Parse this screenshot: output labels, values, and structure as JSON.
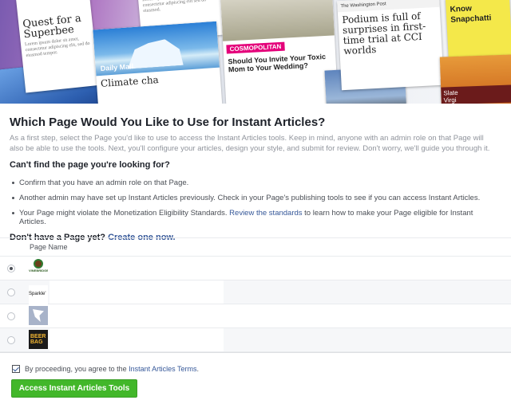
{
  "hero": {
    "cards": {
      "superbee_title": "Quest for a Superbee",
      "climate_title": "Climate cha",
      "dailymail_label": "Daily Mail",
      "cosmo_label": "COSMOPOLITAN",
      "cosmo_title": "Should You Invite Your Toxic Mom to Your Wedding?",
      "wapo_label": "The Washington Post",
      "wapo_title": "Podium is full of surprises in first-time trial at CCI worlds",
      "snap_title": "Know Snapchatti",
      "slate_label": "Slate",
      "slate_text": "Virgi"
    }
  },
  "main": {
    "heading": "Which Page Would You Like to Use for Instant Articles?",
    "intro": "As a first step, select the Page you'd like to use to access the Instant Articles tools. Keep in mind, anyone with an admin role on that Page will also be able to use the tools. Next, you'll configure your articles, design your style, and submit for review. Don't worry, we'll guide you through it.",
    "cant_find": "Can't find the page you're looking for?",
    "tips": {
      "t1": "Confirm that you have an admin role on that Page.",
      "t2": "Another admin may have set up Instant Articles previously. Check in your Page's publishing tools to see if you can access Instant Articles.",
      "t3_before": "Your Page might violate the Monetization Eligibility Standards.",
      "t3_link": "Review the standards",
      "t3_after": "to learn how to make your Page eligible for Instant Articles."
    },
    "no_page": "Don't have a Page yet?",
    "create_link": "Create one now."
  },
  "table": {
    "column_header": "Page Name",
    "rows": [
      {
        "selected": true,
        "thumb_text": "VINEBRIDGE"
      },
      {
        "selected": false,
        "thumb_text": "Sparkle'"
      },
      {
        "selected": false,
        "thumb_text": ""
      },
      {
        "selected": false,
        "thumb_text": "BEER BAG"
      }
    ]
  },
  "footer": {
    "agree_before": "By proceeding, you agree to the",
    "terms_link": "Instant Articles Terms",
    "button_label": "Access Instant Articles Tools",
    "checked": true
  },
  "colors": {
    "link": "#365899",
    "button": "#42b72a"
  }
}
